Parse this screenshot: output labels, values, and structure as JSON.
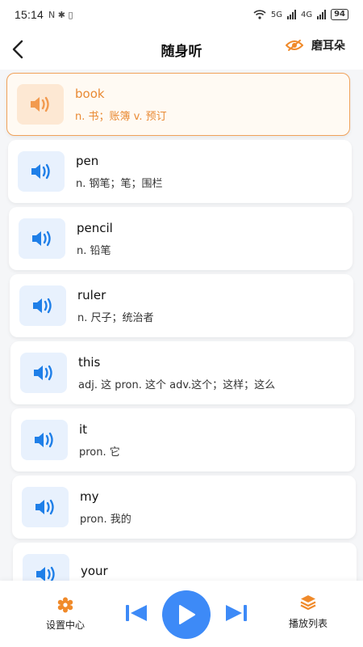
{
  "status_bar": {
    "time": "15:14",
    "left_icons": "N ✱ ▯",
    "network_5g": "5G",
    "network_4g": "4G",
    "battery": "94"
  },
  "header": {
    "title": "随身听",
    "mode_label": "磨耳朵",
    "accent_color": "#f08a2a"
  },
  "words": [
    {
      "word": "book",
      "meaning": "n. 书；账簿 v. 预订",
      "active": true
    },
    {
      "word": "pen",
      "meaning": "n. 钢笔；笔；围栏",
      "active": false
    },
    {
      "word": "pencil",
      "meaning": "n. 铅笔",
      "active": false
    },
    {
      "word": "ruler",
      "meaning": "n. 尺子；统治者",
      "active": false
    },
    {
      "word": "this",
      "meaning": "adj. 这 pron. 这个 adv.这个；这样；这么",
      "active": false
    },
    {
      "word": "it",
      "meaning": "pron. 它",
      "active": false
    },
    {
      "word": "my",
      "meaning": "pron. 我的",
      "active": false
    },
    {
      "word": "your",
      "meaning": "",
      "active": false
    }
  ],
  "bottom_bar": {
    "settings_label": "设置中心",
    "playlist_label": "播放列表",
    "play_color": "#3d8af7",
    "settings_icon": "gear-icon",
    "playlist_icon": "layers-icon"
  }
}
